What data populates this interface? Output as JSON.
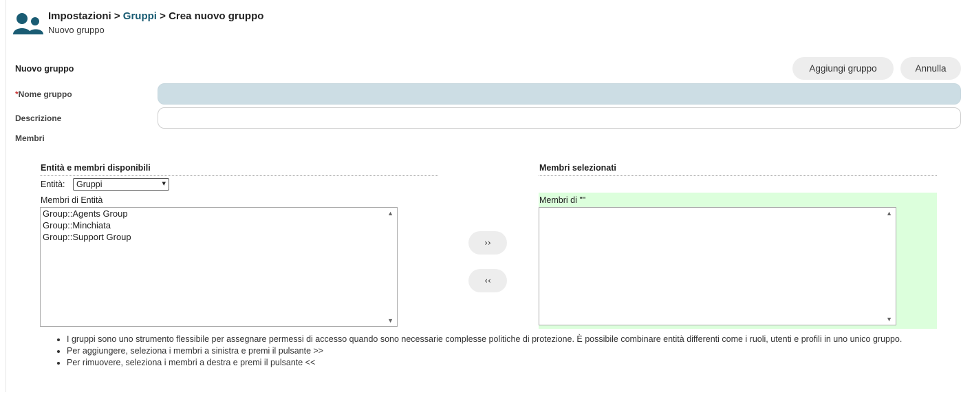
{
  "header": {
    "breadcrumb_root": "Impostazioni",
    "breadcrumb_sep1": " > ",
    "breadcrumb_link": "Gruppi",
    "breadcrumb_sep2": " > ",
    "breadcrumb_current": "Crea nuovo gruppo",
    "subtitle": "Nuovo gruppo",
    "icon": "users-icon"
  },
  "form": {
    "title": "Nuovo gruppo",
    "add_button": "Aggiungi gruppo",
    "cancel_button": "Annulla",
    "required_mark": "*",
    "name_label": "Nome gruppo",
    "name_value": "",
    "description_label": "Descrizione",
    "description_value": "",
    "members_label": "Membri"
  },
  "members": {
    "available_title": "Entità e membri disponibili",
    "entity_label": "Entità:",
    "entity_selected": "Gruppi",
    "entity_members_label": "Membri di Entità",
    "available_items": [
      "Group::Agents Group",
      "Group::Minchiata",
      "Group::Support Group"
    ],
    "add_button": "››",
    "remove_button": "‹‹",
    "selected_title": "Membri selezionati",
    "selected_members_label": "Membri di \"\"",
    "selected_items": []
  },
  "notes": [
    "I gruppi sono uno strumento flessibile per assegnare permessi di accesso quando sono necessarie complesse politiche di protezione. È possibile combinare entità differenti come i ruoli, utenti e profili in uno unico gruppo.",
    "Per aggiungere, seleziona i membri a sinistra e premi il pulsante >>",
    "Per rimuovere, seleziona i membri a destra e premi il pulsante <<"
  ],
  "colors": {
    "accent_link": "#1a5c73",
    "name_field_bg": "#ccdde4",
    "selected_panel_bg": "#dcffdc",
    "button_bg": "#ededed",
    "required": "#cc3a3a"
  }
}
